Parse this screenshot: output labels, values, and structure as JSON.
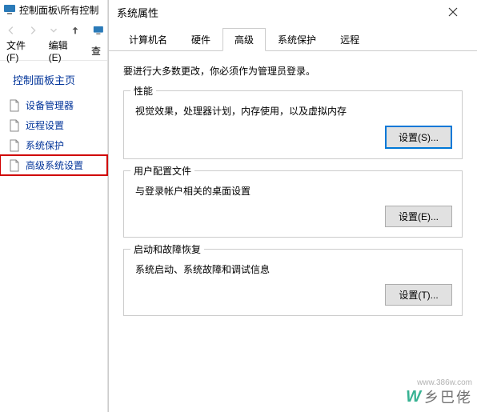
{
  "main": {
    "title": "控制面板\\所有控制",
    "menu": {
      "file": "文件(F)",
      "edit": "编辑(E)",
      "view": "查"
    },
    "side_title": "控制面板主页",
    "side_items": [
      {
        "label": "设备管理器"
      },
      {
        "label": "远程设置"
      },
      {
        "label": "系统保护"
      },
      {
        "label": "高级系统设置"
      }
    ]
  },
  "dialog": {
    "title": "系统属性",
    "tabs": [
      {
        "label": "计算机名"
      },
      {
        "label": "硬件"
      },
      {
        "label": "高级"
      },
      {
        "label": "系统保护"
      },
      {
        "label": "远程"
      }
    ],
    "note": "要进行大多数更改，你必须作为管理员登录。",
    "groups": {
      "perf": {
        "legend": "性能",
        "desc": "视觉效果，处理器计划，内存使用，以及虚拟内存",
        "btn": "设置(S)..."
      },
      "profile": {
        "legend": "用户配置文件",
        "desc": "与登录帐户相关的桌面设置",
        "btn": "设置(E)..."
      },
      "startup": {
        "legend": "启动和故障恢复",
        "desc": "系统启动、系统故障和调试信息",
        "btn": "设置(T)..."
      }
    }
  },
  "watermark": {
    "brand": "乡巴佬",
    "url": "www.386w.com"
  }
}
